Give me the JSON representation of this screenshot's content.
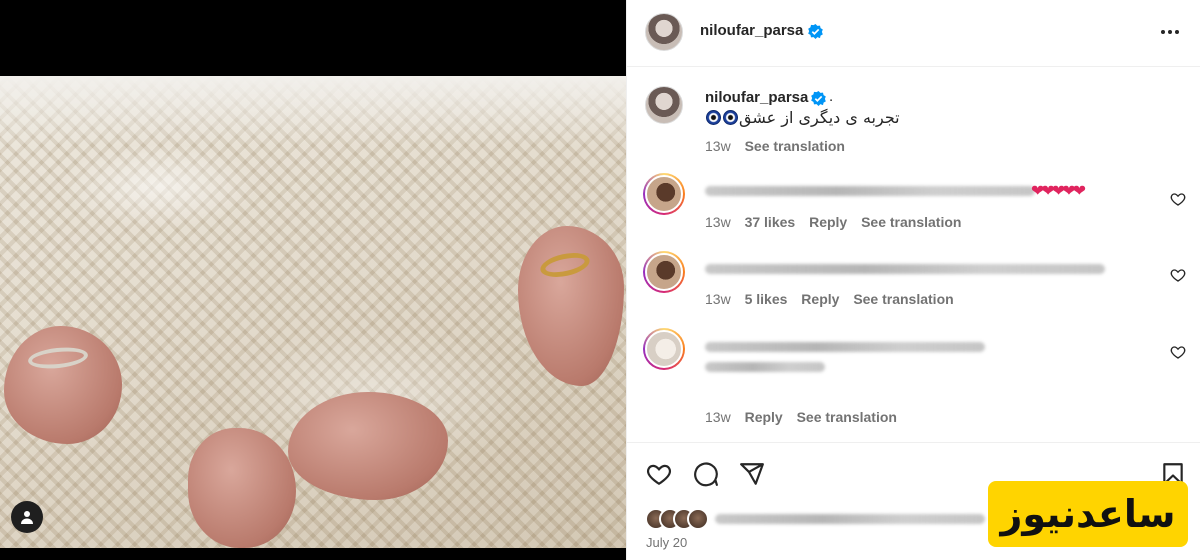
{
  "post": {
    "username": "niloufar_parsa",
    "caption_dot": ".",
    "caption_text": "تجربه ی دیگری از عشق",
    "caption_time": "13w",
    "see_translation": "See translation",
    "date": "July 20"
  },
  "comments": [
    {
      "time": "13w",
      "likes": "37 likes",
      "reply": "Reply",
      "see_translation": "See translation"
    },
    {
      "time": "13w",
      "likes": "5 likes",
      "reply": "Reply",
      "see_translation": "See translation"
    },
    {
      "time": "13w",
      "reply": "Reply",
      "see_translation": "See translation"
    }
  ],
  "watermark": {
    "text": "ساعدنیوز"
  },
  "icons": [
    "user-tag-icon",
    "verified-badge-icon",
    "more-options-icon",
    "heart-icon",
    "comment-icon",
    "share-icon",
    "bookmark-icon",
    "evil-eye-icon"
  ],
  "colors": {
    "verified": "#0095f6",
    "text": "#262626",
    "muted": "#737373",
    "watermark_bg": "#ffd400",
    "heart": "#e0245e"
  }
}
